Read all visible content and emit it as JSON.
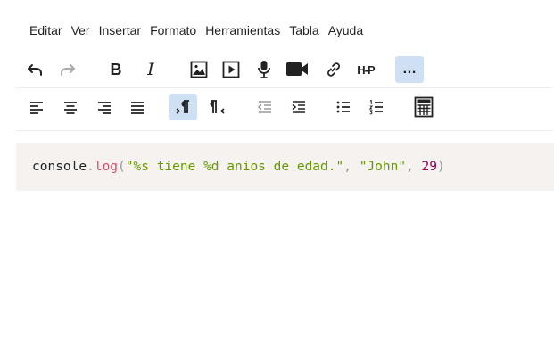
{
  "menu": [
    "Editar",
    "Ver",
    "Insertar",
    "Formato",
    "Herramientas",
    "Tabla",
    "Ayuda"
  ],
  "toolbar1": {
    "undo_icon": "undo-icon",
    "redo_icon": "redo-icon",
    "bold_label": "B",
    "italic_label": "I",
    "image_icon": "image-icon",
    "media_icon": "media-icon",
    "mic_icon": "microphone-icon",
    "video_icon": "video-camera-icon",
    "link_icon": "link-icon",
    "h5p_label": "H-P",
    "more_label": "…"
  },
  "toolbar2": {
    "align_left_icon": "align-left-icon",
    "align_center_icon": "align-center-icon",
    "align_right_icon": "align-right-icon",
    "align_justify_icon": "align-justify-icon",
    "ltr_icon": "ltr-icon",
    "rtl_icon": "rtl-icon",
    "outdent_icon": "outdent-icon",
    "indent_icon": "indent-icon",
    "bullet_list_icon": "bullet-list-icon",
    "numbered_list_icon": "numbered-list-icon",
    "calculator_icon": "calculator-icon"
  },
  "colors": {
    "active_button_bg": "#cfe0f5",
    "code_bg": "#f5f2f0",
    "function": "#dd4a68",
    "string": "#669900",
    "number": "#990055",
    "punctuation": "#999999"
  },
  "code": {
    "tokens": [
      {
        "text": "console",
        "type": "plain"
      },
      {
        "text": ".",
        "type": "punct"
      },
      {
        "text": "log",
        "type": "fn"
      },
      {
        "text": "(",
        "type": "punct"
      },
      {
        "text": "\"%s tiene %d anios de edad.\"",
        "type": "str"
      },
      {
        "text": ", ",
        "type": "punct"
      },
      {
        "text": "\"John\"",
        "type": "str"
      },
      {
        "text": ", ",
        "type": "punct"
      },
      {
        "text": "29",
        "type": "num"
      },
      {
        "text": ")",
        "type": "punct"
      }
    ]
  }
}
